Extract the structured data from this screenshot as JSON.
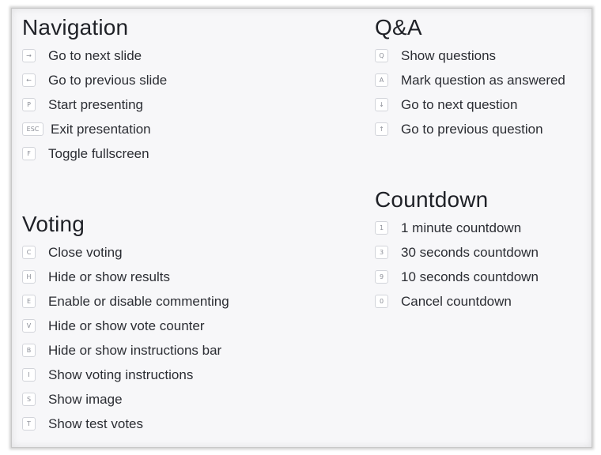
{
  "navigation": {
    "title": "Navigation",
    "items": [
      {
        "key": "→",
        "label": "Go to next slide"
      },
      {
        "key": "←",
        "label": "Go to previous slide"
      },
      {
        "key": "P",
        "label": "Start presenting"
      },
      {
        "key": "ESC",
        "label": "Exit presentation"
      },
      {
        "key": "F",
        "label": "Toggle fullscreen"
      }
    ]
  },
  "voting": {
    "title": "Voting",
    "items": [
      {
        "key": "C",
        "label": "Close voting"
      },
      {
        "key": "H",
        "label": "Hide or show results"
      },
      {
        "key": "E",
        "label": "Enable or disable commenting"
      },
      {
        "key": "V",
        "label": "Hide or show vote counter"
      },
      {
        "key": "B",
        "label": "Hide or show instructions bar"
      },
      {
        "key": "I",
        "label": "Show voting instructions"
      },
      {
        "key": "S",
        "label": "Show image"
      },
      {
        "key": "T",
        "label": "Show test votes"
      }
    ]
  },
  "qa": {
    "title": "Q&A",
    "items": [
      {
        "key": "Q",
        "label": "Show questions"
      },
      {
        "key": "A",
        "label": "Mark question as answered"
      },
      {
        "key": "↓",
        "label": "Go to next question"
      },
      {
        "key": "↑",
        "label": "Go to previous question"
      }
    ]
  },
  "countdown": {
    "title": "Countdown",
    "items": [
      {
        "key": "1",
        "label": "1 minute countdown"
      },
      {
        "key": "3",
        "label": "30 seconds countdown"
      },
      {
        "key": "9",
        "label": "10 seconds countdown"
      },
      {
        "key": "0",
        "label": "Cancel countdown"
      }
    ]
  }
}
